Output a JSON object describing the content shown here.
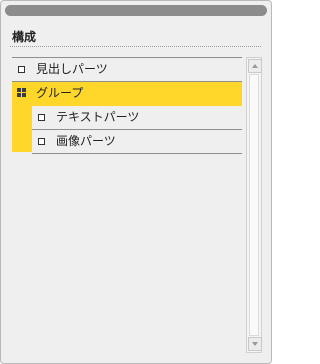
{
  "panel": {
    "heading": "構成"
  },
  "tree": {
    "items": [
      {
        "label": "見出しパーツ",
        "icon": "square-icon",
        "selected": false
      },
      {
        "label": "グループ",
        "icon": "grid-icon",
        "selected": true,
        "children": [
          {
            "label": "テキストパーツ",
            "icon": "square-icon"
          },
          {
            "label": "画像パーツ",
            "icon": "square-icon"
          }
        ]
      }
    ]
  },
  "colors": {
    "selected": "#ffd72a",
    "background": "#efefef",
    "titlebar": "#8c8c8c"
  }
}
